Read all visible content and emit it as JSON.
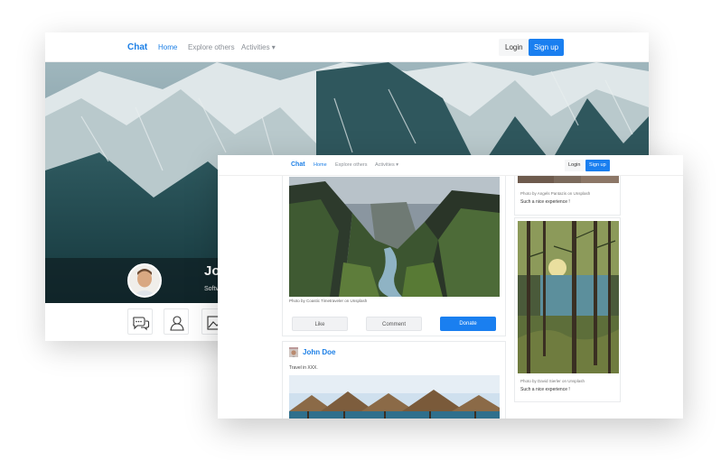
{
  "back_window": {
    "nav": {
      "brand": "Chat",
      "links": [
        "Home",
        "Explore others",
        "Activities"
      ],
      "login": "Login",
      "signup": "Sign up"
    },
    "profile": {
      "name_fragment": "Jo",
      "subtitle_fragment": "Softv"
    },
    "icons": [
      "chat-bubbles-icon",
      "user-icon",
      "image-icon"
    ]
  },
  "front_window": {
    "nav": {
      "brand": "Chat",
      "links": [
        "Home",
        "Explore others",
        "Activities"
      ],
      "login": "Login",
      "signup": "Sign up"
    },
    "main_post": {
      "photo_credit": "Photo by Coastic Timetraveler on Unsplash",
      "actions": [
        "Like",
        "Comment",
        "Donate"
      ]
    },
    "second_post": {
      "author": "John Doe",
      "text": "Travel in XXX."
    },
    "sidebar": {
      "top": {
        "caption": "Photo by Angels Pantazis on Unsplash",
        "text": "Such a nice experience !"
      },
      "bottom": {
        "caption": "Photo by David Sierler on Unsplash",
        "text": "Such a nice experience !"
      }
    }
  },
  "colors": {
    "accent": "#1a7ff0",
    "nav_muted": "#8a8f96"
  }
}
